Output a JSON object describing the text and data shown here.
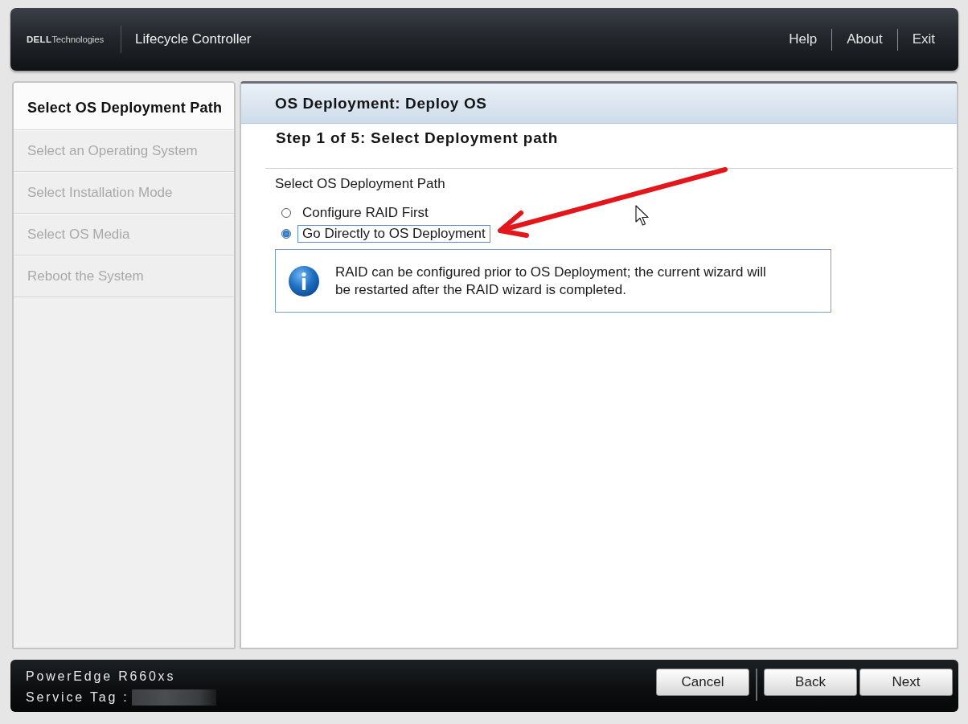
{
  "header": {
    "logo": {
      "brand": "DELL",
      "suffix": "Technologies"
    },
    "title": "Lifecycle Controller",
    "links": [
      "Help",
      "About",
      "Exit"
    ]
  },
  "sidebar": {
    "items": [
      {
        "label": "Select OS Deployment Path",
        "selected": true
      },
      {
        "label": "Select an Operating System",
        "selected": false
      },
      {
        "label": "Select Installation Mode",
        "selected": false
      },
      {
        "label": "Select OS Media",
        "selected": false
      },
      {
        "label": "Reboot the System",
        "selected": false
      }
    ]
  },
  "main": {
    "title": "OS Deployment: Deploy OS",
    "step": "Step 1 of 5: Select Deployment path",
    "group_label": "Select OS Deployment Path",
    "options": [
      {
        "label": "Configure RAID First",
        "selected": false,
        "focused": false
      },
      {
        "label": "Go Directly to OS Deployment",
        "selected": true,
        "focused": true
      }
    ],
    "info": {
      "text": "RAID can be configured prior to OS Deployment; the current wizard will be restarted after the RAID wizard is completed."
    }
  },
  "footer": {
    "model": "PowerEdge R660xs",
    "service_tag_label": "Service Tag :",
    "button_groups": [
      [
        "Cancel"
      ],
      [
        "Back",
        "Next"
      ]
    ]
  }
}
